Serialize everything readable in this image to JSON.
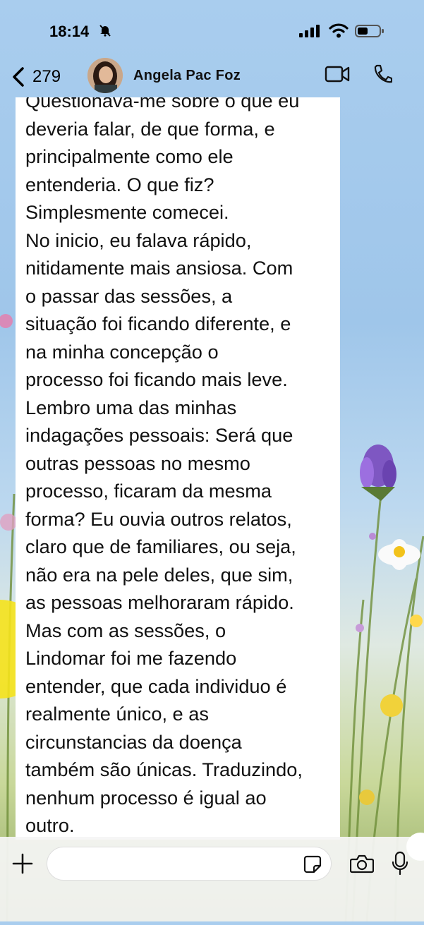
{
  "status_bar": {
    "time": "18:14",
    "icons": [
      "bell-off-icon",
      "signal-icon",
      "wifi-icon",
      "battery-icon"
    ]
  },
  "header": {
    "unread_count": "279",
    "contact_name": "Angela Pac Foz",
    "icons": [
      "back-chevron-icon",
      "avatar",
      "video-call-icon",
      "voice-call-icon"
    ]
  },
  "message": {
    "text": "Questionava-me sobre o que eu\ndeveria falar, de que forma, e\nprincipalmente como ele\nentenderia. O que fiz?\nSimplesmente comecei.\nNo inicio, eu falava rápido,\nnitidamente mais ansiosa. Com\no passar das sessões, a\nsituação foi ficando diferente, e\nna minha concepção o\nprocesso foi ficando mais leve.\nLembro uma das minhas\nindagações pessoais: Será que\noutras pessoas no mesmo\nprocesso, ficaram da mesma\nforma? Eu ouvia outros relatos,\nclaro que de familiares, ou seja,\nnão era na pele deles, que sim,\nas pessoas melhoraram rápido.\nMas com as sessões, o\nLindomar foi me fazendo\nentender, que cada individuo é\nrealmente único, e as\ncircunstancias da doença\ntambém são únicas. Traduzindo,\nnenhum processo é igual ao\noutro."
  },
  "input_bar": {
    "placeholder": "",
    "icons": [
      "plus-icon",
      "sticker-icon",
      "camera-icon",
      "mic-icon"
    ]
  },
  "colors": {
    "bubble": "#ffffff",
    "text": "#111111",
    "sky": "#9fc6ea"
  }
}
